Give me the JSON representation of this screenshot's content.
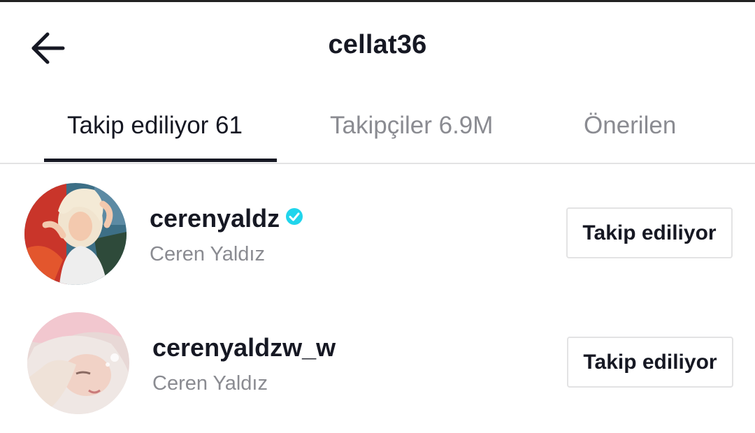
{
  "header": {
    "title": "cellat36",
    "back_icon": "arrow-left-icon"
  },
  "tabs": [
    {
      "label": "Takip ediliyor 61",
      "active": true
    },
    {
      "label": "Takipçiler 6.9M",
      "active": false
    },
    {
      "label": "Önerilen",
      "active": false
    }
  ],
  "users": [
    {
      "username": "cerenyaldz",
      "display_name": "Ceren Yaldız",
      "verified": true,
      "button_label": "Takip ediliyor"
    },
    {
      "username": "cerenyaldzw_w",
      "display_name": "Ceren Yaldız",
      "verified": false,
      "button_label": "Takip ediliyor"
    }
  ],
  "colors": {
    "text_primary": "#161823",
    "text_secondary": "#8a8b91",
    "verified_badge": "#20d5ec",
    "divider": "#e3e3e4"
  }
}
